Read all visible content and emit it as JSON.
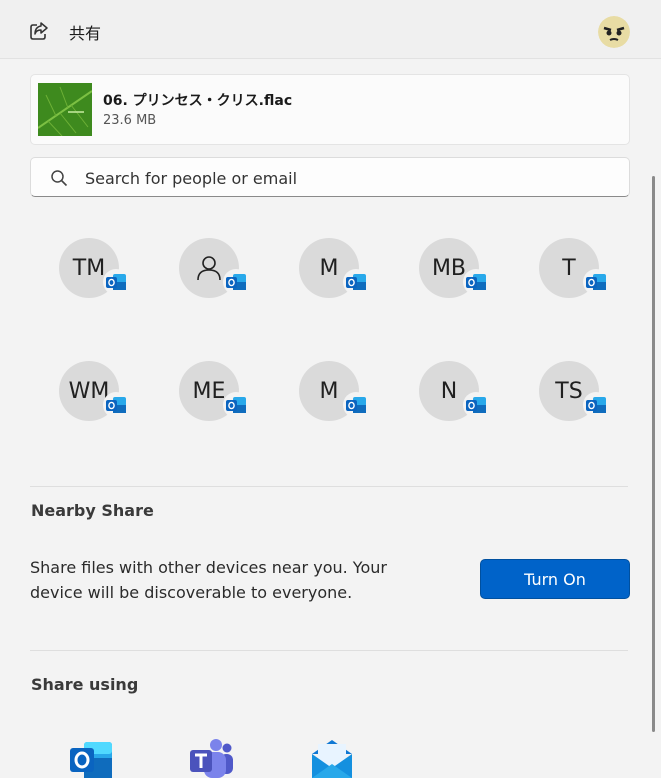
{
  "header": {
    "title": "共有",
    "share_icon": "share-icon",
    "avatar": "user-avatar"
  },
  "file": {
    "name": "06. プリンセス・クリス.flac",
    "size": "23.6 MB",
    "thumbnail": "green-leaf-thumbnail"
  },
  "search": {
    "placeholder": "Search for people or email",
    "value": ""
  },
  "contacts": [
    {
      "initials": "TM"
    },
    {
      "initials": "",
      "icon": "person-icon"
    },
    {
      "initials": "M"
    },
    {
      "initials": "MB"
    },
    {
      "initials": "T"
    },
    {
      "initials": "WM"
    },
    {
      "initials": "ME"
    },
    {
      "initials": "M"
    },
    {
      "initials": "N"
    },
    {
      "initials": "TS"
    }
  ],
  "nearby": {
    "title": "Nearby Share",
    "line1": "Share files with other devices near you. Your",
    "line2": "device will be discoverable to everyone.",
    "button": "Turn On"
  },
  "share_using": {
    "title": "Share using",
    "apps": [
      {
        "icon": "outlook-icon"
      },
      {
        "icon": "teams-icon"
      },
      {
        "icon": "mail-icon"
      }
    ]
  },
  "colors": {
    "accent": "#0063c9",
    "outlook": "#0f6cbd",
    "teams": "#5b5fc7"
  }
}
